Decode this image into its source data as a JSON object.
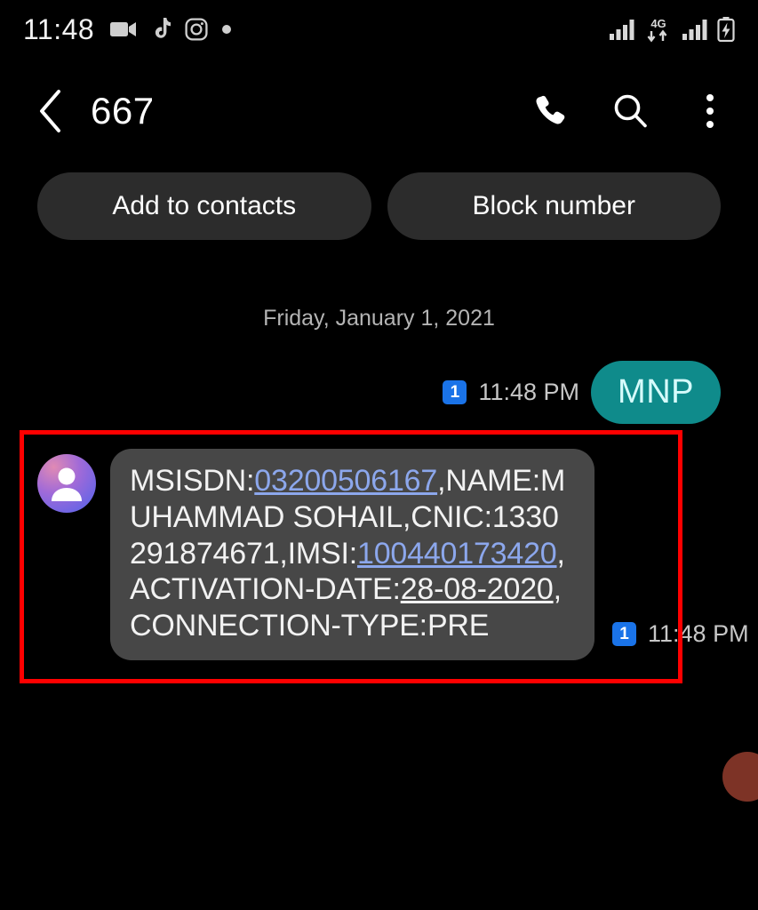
{
  "status_bar": {
    "time": "11:48",
    "left_icons": [
      "video-camera-icon",
      "tiktok-icon",
      "instagram-icon",
      "dot-icon"
    ],
    "right_icons": [
      "signal-bars-icon",
      "4g-data-icon",
      "signal-bars-2-icon",
      "battery-charging-icon"
    ],
    "network_label": "4G"
  },
  "app_bar": {
    "back_icon": "back-chevron-icon",
    "title": "667",
    "call_icon": "phone-call-icon",
    "search_icon": "search-icon",
    "overflow_icon": "more-options-icon"
  },
  "quick_actions": {
    "add_to_contacts": "Add to contacts",
    "block_number": "Block number"
  },
  "conversation": {
    "date_divider": "Friday, January 1, 2021",
    "outgoing": {
      "text": "MNP",
      "sim_badge": "1",
      "timestamp": "11:48 PM",
      "bubble_color": "#0f8b8b"
    },
    "incoming": {
      "avatar_icon": "contact-avatar-icon",
      "sim_badge": "1",
      "timestamp": "11:48 PM",
      "bubble_color": "#474747",
      "full_text": "MSISDN:03200506167,NAME:MUHAMMAD SOHAIL,CNIC:1330291874671,IMSI:100440173420,ACTIVATION-DATE:28-08-2020,CONNECTION-TYPE:PRE",
      "segments": {
        "label_msisdn": "MSISDN:",
        "value_msisdn": "03200506167",
        "label_name": ",NAME:",
        "value_name": "MUHAMMAD SOHAIL",
        "label_cnic": ",CNIC:",
        "value_cnic": "1330291874671",
        "label_imsi": ",IMSI:",
        "value_imsi": "100440173420",
        "label_activation": ",ACTIVATION-DATE:",
        "value_activation": "28-08-2020",
        "label_connection": ",CONNECTION-TYPE:",
        "value_connection": "PRE"
      }
    }
  },
  "annotation": {
    "type": "highlight-rectangle",
    "color": "#fe0000"
  }
}
